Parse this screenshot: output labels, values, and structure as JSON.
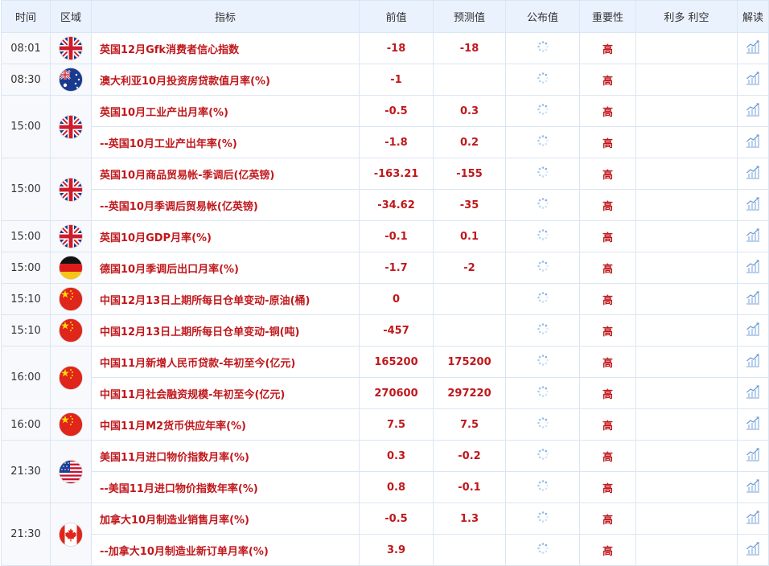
{
  "header": {
    "time": "时间",
    "region": "区域",
    "indicator": "指标",
    "previous": "前值",
    "forecast": "预测值",
    "actual": "公布值",
    "importance": "重要性",
    "impact": "利多 利空",
    "analysis": "解读"
  },
  "groups": [
    {
      "time": "08:01",
      "flag": "uk",
      "rows": [
        {
          "indicator": "英国12月Gfk消费者信心指数",
          "previous": "-18",
          "forecast": "-18",
          "importance": "高"
        }
      ]
    },
    {
      "time": "08:30",
      "flag": "australia",
      "rows": [
        {
          "indicator": "澳大利亚10月投资房贷款值月率(%)",
          "previous": "-1",
          "forecast": "",
          "importance": "高"
        }
      ]
    },
    {
      "time": "15:00",
      "flag": "uk",
      "rows": [
        {
          "indicator": "英国10月工业产出月率(%)",
          "previous": "-0.5",
          "forecast": "0.3",
          "importance": "高"
        },
        {
          "indicator": "--英国10月工业产出年率(%)",
          "previous": "-1.8",
          "forecast": "0.2",
          "importance": "高"
        }
      ]
    },
    {
      "time": "15:00",
      "flag": "uk",
      "rows": [
        {
          "indicator": "英国10月商品贸易帐-季调后(亿英镑)",
          "previous": "-163.21",
          "forecast": "-155",
          "importance": "高"
        },
        {
          "indicator": "--英国10月季调后贸易帐(亿英镑)",
          "previous": "-34.62",
          "forecast": "-35",
          "importance": "高"
        }
      ]
    },
    {
      "time": "15:00",
      "flag": "uk",
      "rows": [
        {
          "indicator": "英国10月GDP月率(%)",
          "previous": "-0.1",
          "forecast": "0.1",
          "importance": "高"
        }
      ]
    },
    {
      "time": "15:00",
      "flag": "germany",
      "rows": [
        {
          "indicator": "德国10月季调后出口月率(%)",
          "previous": "-1.7",
          "forecast": "-2",
          "importance": "高"
        }
      ]
    },
    {
      "time": "15:10",
      "flag": "china",
      "rows": [
        {
          "indicator": "中国12月13日上期所每日仓单变动-原油(桶)",
          "previous": "0",
          "forecast": "",
          "importance": "高"
        }
      ]
    },
    {
      "time": "15:10",
      "flag": "china",
      "rows": [
        {
          "indicator": "中国12月13日上期所每日仓单变动-铜(吨)",
          "previous": "-457",
          "forecast": "",
          "importance": "高"
        }
      ]
    },
    {
      "time": "16:00",
      "flag": "china",
      "rows": [
        {
          "indicator": "中国11月新增人民币贷款-年初至今(亿元)",
          "previous": "165200",
          "forecast": "175200",
          "importance": "高"
        },
        {
          "indicator": "中国11月社会融资规模-年初至今(亿元)",
          "previous": "270600",
          "forecast": "297220",
          "importance": "高"
        }
      ]
    },
    {
      "time": "16:00",
      "flag": "china",
      "rows": [
        {
          "indicator": "中国11月M2货币供应年率(%)",
          "previous": "7.5",
          "forecast": "7.5",
          "importance": "高"
        }
      ]
    },
    {
      "time": "21:30",
      "flag": "usa",
      "rows": [
        {
          "indicator": "美国11月进口物价指数月率(%)",
          "previous": "0.3",
          "forecast": "-0.2",
          "importance": "高"
        },
        {
          "indicator": "--美国11月进口物价指数年率(%)",
          "previous": "0.8",
          "forecast": "-0.1",
          "importance": "高"
        }
      ]
    },
    {
      "time": "21:30",
      "flag": "canada",
      "rows": [
        {
          "indicator": "加拿大10月制造业销售月率(%)",
          "previous": "-0.5",
          "forecast": "1.3",
          "importance": "高"
        },
        {
          "indicator": "--加拿大10月制造业新订单月率(%)",
          "previous": "3.9",
          "forecast": "",
          "importance": "高"
        }
      ]
    }
  ]
}
